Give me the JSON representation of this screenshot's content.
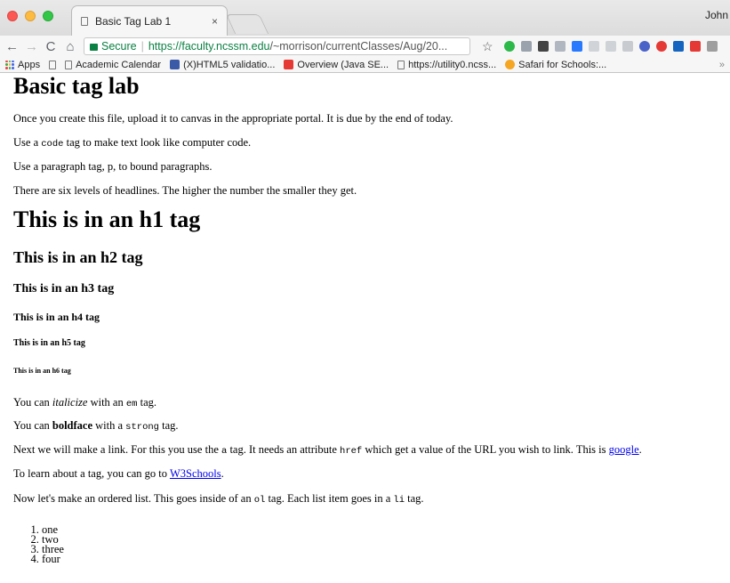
{
  "browser": {
    "tab_title": "Basic Tag Lab 1",
    "tab_close": "×",
    "user_name": "John",
    "back": "←",
    "forward": "→",
    "reload": "C",
    "home": "⌂",
    "secure_label": "Secure",
    "url_host": "https://faculty.ncssm.edu",
    "url_path": "/~morrison/currentClasses/Aug/20...",
    "star": "☆",
    "bookmarks": [
      {
        "label": "Apps",
        "icon": "apps-grid-icon"
      },
      {
        "label": "",
        "icon": "page-icon"
      },
      {
        "label": "Academic Calendar",
        "icon": "page-icon"
      },
      {
        "label": "(X)HTML5 validatio...",
        "icon": "validator-icon",
        "color": "#3a5aa8"
      },
      {
        "label": "Overview (Java SE...",
        "icon": "oracle-icon",
        "color": "#e53935"
      },
      {
        "label": "https://utility0.ncss...",
        "icon": "page-icon"
      },
      {
        "label": "Safari for Schools:...",
        "icon": "safari-icon",
        "color": "#f5a623"
      }
    ],
    "bookmarks_more": "»",
    "extensions": [
      "#2db84a",
      "#9aa3ad",
      "#444444",
      "#b0b7c0",
      "#2979ff",
      "#d0d4d8",
      "#cfd3d7",
      "#c8ccd0",
      "#4a63c9",
      "#e53935",
      "#1565c0",
      "#e53935",
      "#9e9e9e"
    ]
  },
  "page": {
    "title": "Basic tag lab",
    "intro": "Once you create this file, upload it to canvas in the appropriate portal. It is due by the end of today.",
    "code_pre": "Use a ",
    "code_tag": "code",
    "code_post": " tag to make text look like computer code.",
    "para_line": "Use a paragraph tag, p, to bound paragraphs.",
    "headline_line": "There are six levels of headlines. The higher the number the smaller they get.",
    "h1": "This is in an h1 tag",
    "h2": "This is in an h2 tag",
    "h3": "This is in an h3 tag",
    "h4": "This is in an h4 tag",
    "h5": "This is in an h5 tag",
    "h6": "This is in an h6 tag",
    "em_pre": "You can ",
    "em_word": "italicize",
    "em_mid": " with an ",
    "em_tag": "em",
    "em_post": " tag.",
    "strong_pre": "You can ",
    "strong_word": "boldface",
    "strong_mid": " with a ",
    "strong_tag": "strong",
    "strong_post": " tag.",
    "link_pre": "Next we will make a link. For this you use the ",
    "link_tag": "a",
    "link_mid1": " tag. It needs an attribute ",
    "link_attr": "href",
    "link_mid2": " which get a value of the URL you wish to link. This is ",
    "link_google": "google",
    "link_post": ".",
    "learn_pre": "To learn about a tag, you can go to ",
    "learn_link": "W3Schools",
    "learn_post": ".",
    "ol_pre": "Now let's make an ordered list. This goes inside of an ",
    "ol_tag": "ol",
    "ol_mid": " tag. Each list item goes in a ",
    "li_tag": "li",
    "ol_post": " tag.",
    "list_items": [
      "one",
      "two",
      "three",
      "four"
    ]
  }
}
